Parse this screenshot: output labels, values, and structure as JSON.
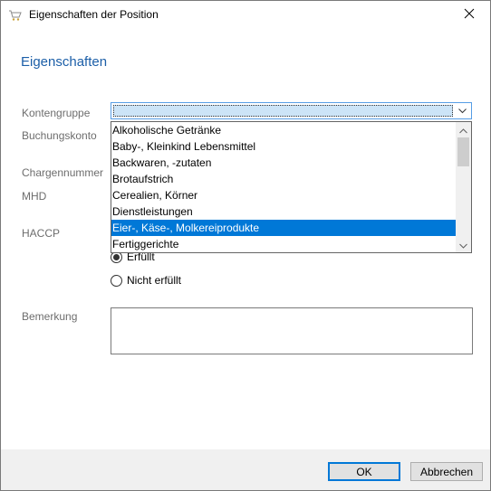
{
  "window": {
    "title": "Eigenschaften der Position"
  },
  "section": {
    "heading": "Eigenschaften"
  },
  "labels": {
    "kontengruppe": "Kontengruppe",
    "buchungskonto": "Buchungskonto",
    "chargennummer": "Chargennummer",
    "mhd": "MHD",
    "haccp": "HACCP",
    "bemerkung": "Bemerkung"
  },
  "kontengruppe_combo": {
    "value": "",
    "options": [
      "Alkoholische Getränke",
      "Baby-, Kleinkind Lebensmittel",
      "Backwaren, -zutaten",
      "Brotaufstrich",
      "Cerealien, Körner",
      "Dienstleistungen",
      "Eier-, Käse-, Molkereiprodukte",
      "Fertiggerichte"
    ],
    "highlighted": "Eier-, Käse-, Molkereiprodukte"
  },
  "haccp": {
    "options": [
      {
        "label": "Erfüllt",
        "checked": true
      },
      {
        "label": "Nicht erfüllt",
        "checked": false
      }
    ]
  },
  "bemerkung": {
    "value": ""
  },
  "buttons": {
    "ok": "OK",
    "cancel": "Abbrechen"
  },
  "colors": {
    "heading": "#1c5fa8",
    "selection": "#0078d7",
    "combo_focus": "#cce4f7"
  }
}
